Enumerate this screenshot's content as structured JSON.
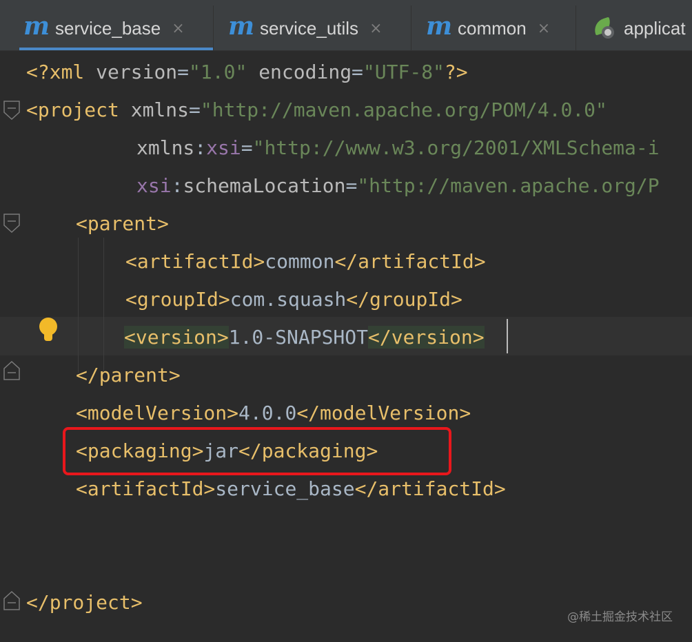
{
  "tabs": [
    {
      "label": "service_base",
      "icon": "maven-m-icon",
      "active": true
    },
    {
      "label": "service_utils",
      "icon": "maven-m-icon",
      "active": false
    },
    {
      "label": "common",
      "icon": "maven-m-icon",
      "active": false
    },
    {
      "label": "applicat",
      "icon": "spring-boot-icon",
      "active": false
    }
  ],
  "maven_glyph": "m",
  "close_glyph": "×",
  "code": {
    "l1": {
      "open": "<?xml ",
      "a1": "version",
      "eq1": "=",
      "v1": "\"1.0\"",
      "sp": " ",
      "a2": "encoding",
      "eq2": "=",
      "v2": "\"UTF-8\"",
      "close": "?>"
    },
    "l2": {
      "open": "<project ",
      "a": "xmlns",
      "eq": "=",
      "v": "\"http://maven.apache.org/POM/4.0.0\""
    },
    "l3": {
      "a": "xmlns",
      "colon": ":",
      "ns": "xsi",
      "eq": "=",
      "v": "\"http://www.w3.org/2001/XMLSchema-i"
    },
    "l4": {
      "ns": "xsi",
      "colon": ":",
      "a": "schemaLocation",
      "eq": "=",
      "v": "\"http://maven.apache.org/P"
    },
    "l5": {
      "tag": "<parent>"
    },
    "l6": {
      "open": "<artifactId>",
      "text": "common",
      "close": "</artifactId>"
    },
    "l7": {
      "open": "<groupId>",
      "text": "com.squash",
      "close": "</groupId>"
    },
    "l8": {
      "open": "<version>",
      "text": "1.0-SNAPSHOT",
      "close": "</version>"
    },
    "l9": {
      "tag": "</parent>"
    },
    "l10": {
      "open": "<modelVersion>",
      "text": "4.0.0",
      "close": "</modelVersion>"
    },
    "l11": {
      "open": "<packaging>",
      "text": "jar",
      "close": "</packaging>"
    },
    "l12": {
      "open": "<artifactId>",
      "text": "service_base",
      "close": "</artifactId>"
    },
    "l13": {
      "tag": "</project>"
    }
  },
  "watermark": "@稀土掘金技术社区",
  "colors": {
    "tag": "#e8bf6a",
    "string": "#6a8759",
    "namespace": "#9876aa",
    "text": "#a9b7c6",
    "highlight_box": "#e8171c",
    "accent": "#4a88c7"
  }
}
